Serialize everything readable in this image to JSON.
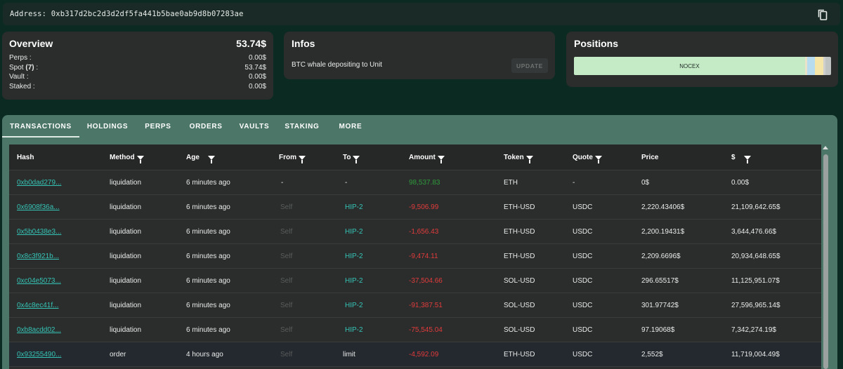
{
  "address": {
    "label": "Address:",
    "value": "0xb317d2bc2d3d2df5fa441b5bae0ab9d8b07283ae"
  },
  "overview": {
    "title": "Overview",
    "total": "53.74$",
    "rows": [
      {
        "label": "Perps :",
        "value": "0.00$"
      },
      {
        "label": "Spot ",
        "count": "(7)",
        "suffix": " :",
        "value": "53.74$"
      },
      {
        "label": "Vault :",
        "value": "0.00$"
      },
      {
        "label": "Staked :",
        "value": "0.00$"
      }
    ]
  },
  "infos": {
    "title": "Infos",
    "message": "BTC whale depositing to Unit",
    "update_label": "UPDATE"
  },
  "positions": {
    "title": "Positions",
    "main_label": "NOCEX"
  },
  "tabs": [
    "TRANSACTIONS",
    "HOLDINGS",
    "PERPS",
    "ORDERS",
    "VAULTS",
    "STAKING",
    "MORE"
  ],
  "table": {
    "headers": [
      "Hash",
      "Method",
      "Age",
      "From",
      "To",
      "Amount",
      "Token",
      "Quote",
      "Price",
      "$"
    ],
    "rows": [
      {
        "hash": "0xb0dad279...",
        "method": "liquidation",
        "age": "6 minutes ago",
        "from": "-",
        "to": "-",
        "amount": "98,537.83",
        "token": "ETH",
        "quote": "-",
        "price": "0$",
        "usd": "0.00$"
      },
      {
        "hash": "0x6908f36a...",
        "method": "liquidation",
        "age": "6 minutes ago",
        "from": "Self",
        "to": "HIP-2",
        "amount": "-9,506.99",
        "token": "ETH-USD",
        "quote": "USDC",
        "price": "2,220.43406$",
        "usd": "21,109,642.65$"
      },
      {
        "hash": "0x5b0438e3...",
        "method": "liquidation",
        "age": "6 minutes ago",
        "from": "Self",
        "to": "HIP-2",
        "amount": "-1,656.43",
        "token": "ETH-USD",
        "quote": "USDC",
        "price": "2,200.19431$",
        "usd": "3,644,476.66$"
      },
      {
        "hash": "0x8c3f921b...",
        "method": "liquidation",
        "age": "6 minutes ago",
        "from": "Self",
        "to": "HIP-2",
        "amount": "-9,474.11",
        "token": "ETH-USD",
        "quote": "USDC",
        "price": "2,209.6696$",
        "usd": "20,934,648.65$"
      },
      {
        "hash": "0xc04e5073...",
        "method": "liquidation",
        "age": "6 minutes ago",
        "from": "Self",
        "to": "HIP-2",
        "amount": "-37,504.66",
        "token": "SOL-USD",
        "quote": "USDC",
        "price": "296.65517$",
        "usd": "11,125,951.07$"
      },
      {
        "hash": "0x4c8ec41f...",
        "method": "liquidation",
        "age": "6 minutes ago",
        "from": "Self",
        "to": "HIP-2",
        "amount": "-91,387.51",
        "token": "SOL-USD",
        "quote": "USDC",
        "price": "301.97742$",
        "usd": "27,596,965.14$"
      },
      {
        "hash": "0xb8acdd02...",
        "method": "liquidation",
        "age": "6 minutes ago",
        "from": "Self",
        "to": "HIP-2",
        "amount": "-75,545.04",
        "token": "SOL-USD",
        "quote": "USDC",
        "price": "97.19068$",
        "usd": "7,342,274.19$"
      },
      {
        "hash": "0x93255490...",
        "method": "order",
        "age": "4 hours ago",
        "from": "Self",
        "to": "limit",
        "amount": "-4,592.09",
        "token": "ETH-USD",
        "quote": "USDC",
        "price": "2,552$",
        "usd": "11,719,004.49$"
      }
    ]
  },
  "colors": {
    "background": "#0b2a22",
    "card": "#2b2d2d",
    "tabs_panel": "#4c7668",
    "link": "#35c4b5",
    "negative": "#e33b3b",
    "positive": "#2e9a3a",
    "position_main": "#c4eac6"
  }
}
